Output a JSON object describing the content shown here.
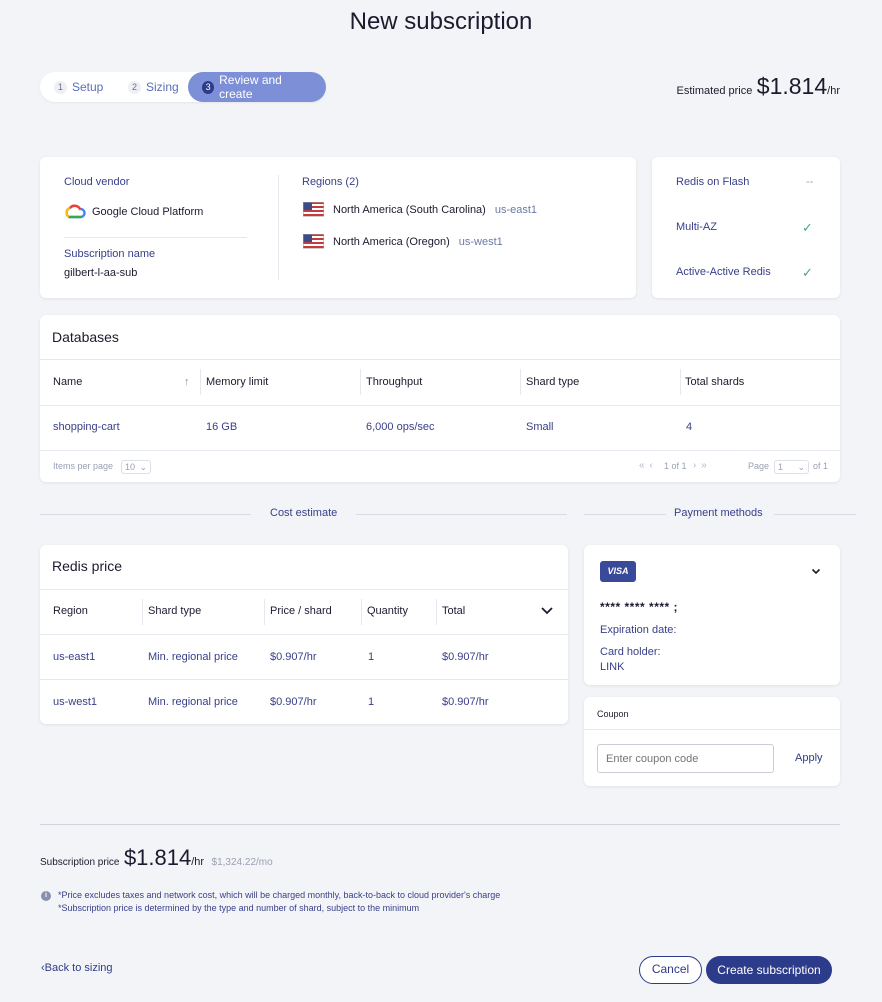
{
  "page_title": "New subscription",
  "stepper": {
    "steps": [
      {
        "num": "1",
        "label": "Setup"
      },
      {
        "num": "2",
        "label": "Sizing"
      },
      {
        "num": "3",
        "label": "Review and create"
      }
    ]
  },
  "estimate": {
    "label": "Estimated price",
    "value": "$1.814",
    "unit": "/hr"
  },
  "summary": {
    "cloud_vendor_label": "Cloud vendor",
    "cloud_vendor": "Google Cloud Platform",
    "subscription_name_label": "Subscription name",
    "subscription_name": "gilbert-l-aa-sub",
    "regions_label": "Regions (2)",
    "regions": [
      {
        "name": "North America (South Carolina)",
        "code": "us-east1"
      },
      {
        "name": "North America (Oregon)",
        "code": "us-west1"
      }
    ]
  },
  "features": {
    "flash_label": "Redis on Flash",
    "flash_value": "--",
    "multiaz_label": "Multi-AZ",
    "multiaz_value": "✓",
    "aa_label": "Active-Active Redis",
    "aa_value": "✓"
  },
  "databases": {
    "title": "Databases",
    "columns": [
      "Name",
      "Memory limit",
      "Throughput",
      "Shard type",
      "Total shards"
    ],
    "sort_icon": "↑",
    "rows": [
      [
        "shopping-cart",
        "16 GB",
        "6,000 ops/sec",
        "Small",
        "4"
      ]
    ],
    "items_per_page_label": "Items per page",
    "items_per_page": "10",
    "pagination_info": "1 of 1",
    "page_label": "Page",
    "page_value": "1",
    "of_label": "of 1"
  },
  "cost": {
    "section_label": "Cost estimate",
    "title": "Redis price",
    "columns": [
      "Region",
      "Shard type",
      "Price / shard",
      "Quantity",
      "Total"
    ],
    "rows": [
      [
        "us-east1",
        "Min. regional price",
        "$0.907/hr",
        "1",
        "$0.907/hr"
      ],
      [
        "us-west1",
        "Min. regional price",
        "$0.907/hr",
        "1",
        "$0.907/hr"
      ]
    ]
  },
  "payment": {
    "section_label": "Payment methods",
    "card_brand": "VISA",
    "card_number": "**** **** **** ;",
    "expiration_label": "Expiration date:",
    "holder_label": "Card holder:",
    "holder_value": "LINK"
  },
  "coupon": {
    "label": "Coupon",
    "placeholder": "Enter coupon code",
    "apply": "Apply"
  },
  "subscription_price": {
    "label": "Subscription price",
    "value": "$1.814",
    "unit": "/hr",
    "monthly": "$1,324.22/mo",
    "note1": "*Price excludes taxes and network cost, which will be charged monthly, back-to-back to cloud provider's charge",
    "note2": "*Subscription price is determined by the type and number of shard, subject to the minimum"
  },
  "footer": {
    "back": "Back to sizing",
    "cancel": "Cancel",
    "create": "Create subscription"
  },
  "colors": {
    "primary": "#2d3c8a",
    "active_step": "#7d8fd7",
    "check": "#4aa47a"
  }
}
